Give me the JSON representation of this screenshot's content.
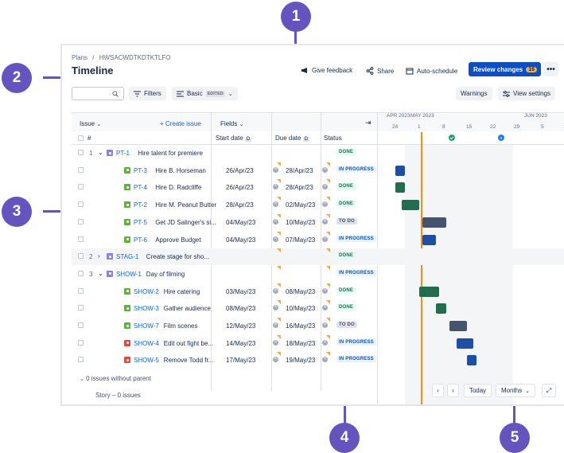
{
  "header": {
    "breadcrumb_root": "Plans",
    "breadcrumb_sep": "/",
    "breadcrumb_plan": "HWSACWDTKDTKTLFO",
    "title": "Timeline",
    "give_feedback": "Give feedback",
    "share": "Share",
    "auto_schedule": "Auto-schedule",
    "review_changes": "Review changes",
    "review_count": "16",
    "more": "•••"
  },
  "toolbar": {
    "filters": "Filters",
    "view_mode": "Basic",
    "edited_badge": "EDITED",
    "warnings": "Warnings",
    "view_settings": "View settings"
  },
  "columns": {
    "issue": "Issue",
    "create_issue": "+ Create issue",
    "fields": "Fields",
    "hash": "#",
    "start_date": "Start date",
    "start_badge": "D",
    "due_date": "Due date",
    "due_badge": "D",
    "status": "Status"
  },
  "timeline": {
    "months": [
      "APR 2023",
      "MAY 2023",
      "JUN 2023"
    ],
    "days": [
      "24",
      "1",
      "8",
      "15",
      "22",
      "29",
      "5",
      "12"
    ]
  },
  "rows": [
    {
      "num": "1",
      "key": "PT-1",
      "summary": "Hire talent for premiere",
      "start": "",
      "due": "",
      "status": "DONE",
      "type": "epic",
      "level": 0,
      "expand": true
    },
    {
      "num": "",
      "key": "PT-3",
      "summary": "Hire B. Horseman",
      "start": "26/Apr/23",
      "due": "28/Apr/23",
      "status": "IN PROGRESS",
      "type": "story",
      "level": 1
    },
    {
      "num": "",
      "key": "PT-4",
      "summary": "Hire D. Radcliffe",
      "start": "26/Apr/23",
      "due": "28/Apr/23",
      "status": "DONE",
      "type": "story",
      "level": 1
    },
    {
      "num": "",
      "key": "PT-2",
      "summary": "Hire M. Peanut Butter",
      "start": "28/Apr/23",
      "due": "02/May/23",
      "status": "DONE",
      "type": "story",
      "level": 1
    },
    {
      "num": "",
      "key": "PT-5",
      "summary": "Get JD Salinger's si...",
      "start": "04/May/23",
      "due": "10/May/23",
      "status": "TO DO",
      "type": "story",
      "level": 1
    },
    {
      "num": "",
      "key": "PT-6",
      "summary": "Approve Budget",
      "start": "04/May/23",
      "due": "07/May/23",
      "status": "IN PROGRESS",
      "type": "story",
      "level": 1
    },
    {
      "num": "2",
      "key": "STAG-1",
      "summary": "Create stage for sho...",
      "start": "",
      "due": "",
      "status": "DONE",
      "type": "epic",
      "level": 0,
      "expand": false
    },
    {
      "num": "3",
      "key": "SHOW-1",
      "summary": "Day of filming",
      "start": "",
      "due": "",
      "status": "IN PROGRESS",
      "type": "epic",
      "level": 0,
      "expand": true
    },
    {
      "num": "",
      "key": "SHOW-2",
      "summary": "Hire catering",
      "start": "03/May/23",
      "due": "08/May/23",
      "status": "DONE",
      "type": "story",
      "level": 1
    },
    {
      "num": "",
      "key": "SHOW-3",
      "summary": "Gather audience",
      "start": "08/May/23",
      "due": "10/May/23",
      "status": "DONE",
      "type": "story",
      "level": 1
    },
    {
      "num": "",
      "key": "SHOW-7",
      "summary": "Film scenes",
      "start": "12/May/23",
      "due": "16/May/23",
      "status": "TO DO",
      "type": "story",
      "level": 1
    },
    {
      "num": "",
      "key": "SHOW-4",
      "summary": "Edit out fight be...",
      "start": "14/May/23",
      "due": "18/May/23",
      "status": "IN PROGRESS",
      "type": "bug",
      "level": 1
    },
    {
      "num": "",
      "key": "SHOW-5",
      "summary": "Remove Todd fr...",
      "start": "17/May/23",
      "due": "19/May/23",
      "status": "IN PROGRESS",
      "type": "bug",
      "level": 1
    }
  ],
  "footer": {
    "no_parent": "0 issues without parent",
    "story_count": "Story – 0 issues",
    "today": "Today",
    "months": "Months"
  },
  "callouts": [
    "1",
    "2",
    "3",
    "4",
    "5"
  ],
  "colors": {
    "primary": "#0c4ec6",
    "done_bar": "#216e4e",
    "todo_bar": "#44546f",
    "prog_bar": "#1d4fa8",
    "today_line": "#f18d13",
    "callout": "#6554c0"
  }
}
